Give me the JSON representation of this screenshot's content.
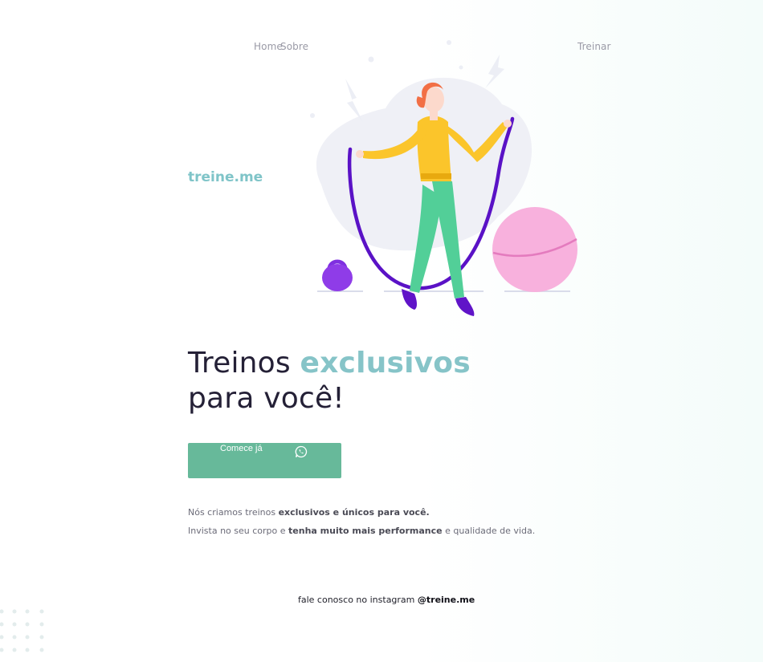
{
  "nav": {
    "home": "Home",
    "sobre": "Sobre",
    "treinar": "Treinar"
  },
  "brand": {
    "name": "treine.me"
  },
  "hero": {
    "title_part1": "Treinos ",
    "title_accent": "exclusivos",
    "title_part2": "para você!"
  },
  "cta": {
    "label": "Comece já",
    "icon": "whatsapp-icon"
  },
  "description": {
    "line1_plain": "Nós criamos treinos ",
    "line1_bold": "exclusivos e únicos para você.",
    "line2_plain1": "Invista no seu corpo e ",
    "line2_bold": "tenha muito mais performance",
    "line2_plain2": " e qualidade de vida."
  },
  "footer": {
    "text": "fale conosco no instagram ",
    "handle": "@treine.me"
  },
  "colors": {
    "accent": "#86c4c8",
    "button": "#67b99a",
    "heading": "#242036"
  }
}
